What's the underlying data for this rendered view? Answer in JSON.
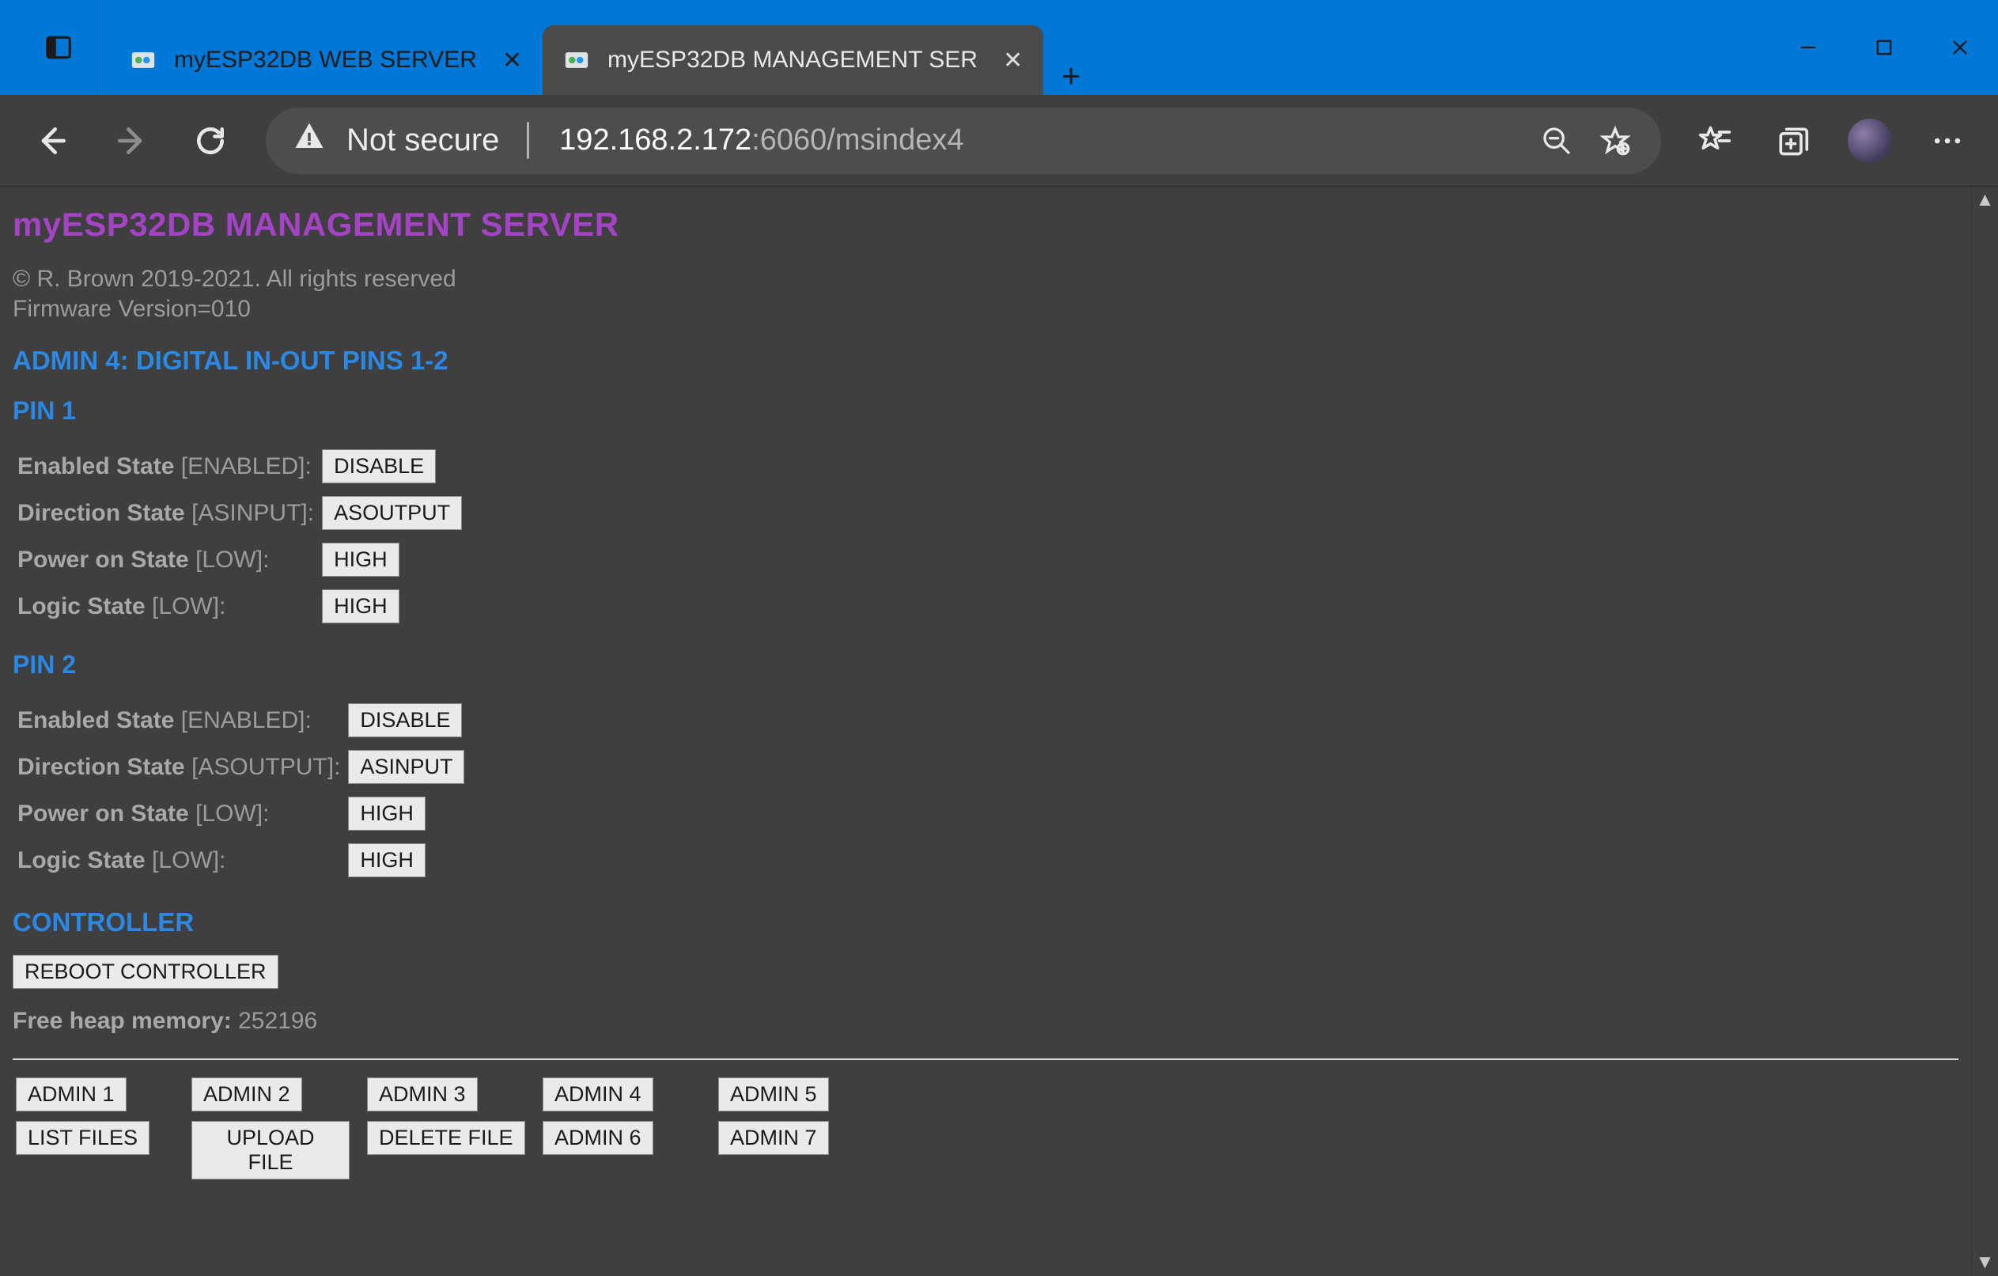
{
  "browser": {
    "tabs": [
      {
        "title": "myESP32DB WEB SERVER",
        "active": false
      },
      {
        "title": "myESP32DB MANAGEMENT SER",
        "active": true
      }
    ],
    "security_label": "Not secure",
    "url_host": "192.168.2.172",
    "url_rest": ":6060/msindex4"
  },
  "page": {
    "title": "myESP32DB MANAGEMENT SERVER",
    "copyright_line1": "© R. Brown 2019-2021. All rights reserved",
    "copyright_line2": "Firmware Version=010",
    "section_heading": "ADMIN 4: DIGITAL IN-OUT PINS 1-2",
    "pin1": {
      "heading": "PIN 1",
      "rows": [
        {
          "label": "Enabled State",
          "value": "[ENABLED]:",
          "button": "DISABLE"
        },
        {
          "label": "Direction State",
          "value": "[ASINPUT]:",
          "button": "ASOUTPUT"
        },
        {
          "label": "Power on State",
          "value": "[LOW]:",
          "button": "HIGH"
        },
        {
          "label": "Logic State",
          "value": "[LOW]:",
          "button": "HIGH"
        }
      ]
    },
    "pin2": {
      "heading": "PIN 2",
      "rows": [
        {
          "label": "Enabled State",
          "value": "[ENABLED]:",
          "button": "DISABLE"
        },
        {
          "label": "Direction State",
          "value": "[ASOUTPUT]:",
          "button": "ASINPUT"
        },
        {
          "label": "Power on State",
          "value": "[LOW]:",
          "button": "HIGH"
        },
        {
          "label": "Logic State",
          "value": "[LOW]:",
          "button": "HIGH"
        }
      ]
    },
    "controller": {
      "heading": "CONTROLLER",
      "reboot_button": "REBOOT CONTROLLER",
      "heap_label": "Free heap memory:",
      "heap_value": "252196"
    },
    "nav": {
      "row1": [
        "ADMIN 1",
        "ADMIN 2",
        "ADMIN 3",
        "ADMIN 4",
        "ADMIN 5"
      ],
      "row2": [
        "LIST FILES",
        "UPLOAD FILE",
        "DELETE FILE",
        "ADMIN 6",
        "ADMIN 7"
      ]
    }
  }
}
